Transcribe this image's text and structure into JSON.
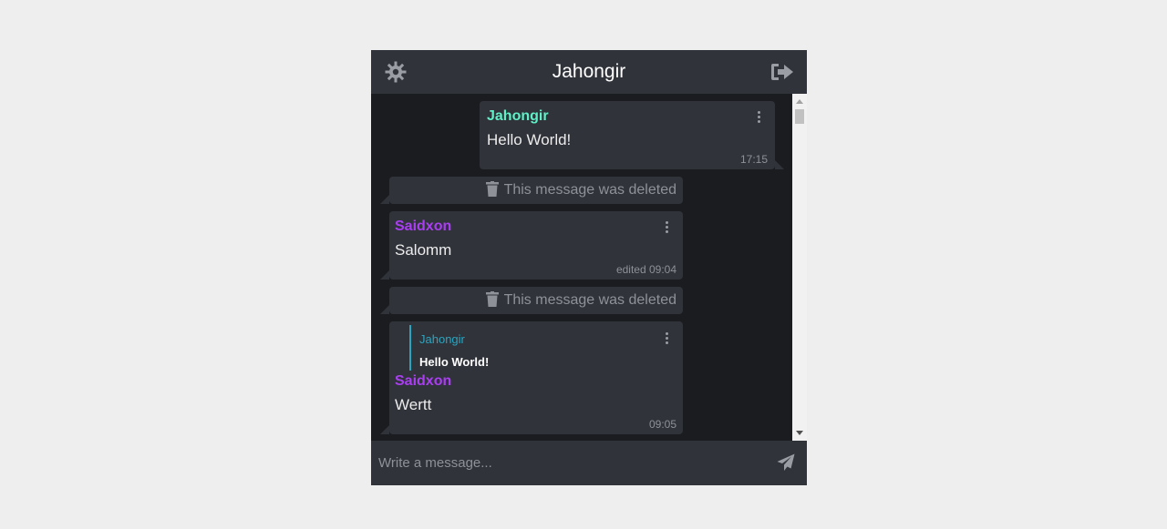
{
  "header": {
    "title": "Jahongir",
    "settings_icon": "gear-icon",
    "logout_icon": "sign-out-icon"
  },
  "colors": {
    "page_bg": "#eeeeee",
    "chat_bg": "#1b1c1f",
    "bubble_bg": "#30333a",
    "self_name": "#5ff0c8",
    "other_name": "#a93ff0",
    "reply_accent": "#2aa5c0"
  },
  "messages": [
    {
      "type": "outgoing",
      "sender": "Jahongir",
      "text": "Hello World!",
      "time": "17:15"
    },
    {
      "type": "deleted",
      "text": "This message was deleted"
    },
    {
      "type": "incoming",
      "sender": "Saidxon",
      "text": "Salomm",
      "time": "edited 09:04"
    },
    {
      "type": "deleted",
      "text": "This message was deleted"
    },
    {
      "type": "incoming",
      "sender": "Saidxon",
      "text": "Wertt",
      "time": "09:05",
      "reply": {
        "sender": "Jahongir",
        "text": "Hello World!"
      }
    }
  ],
  "composer": {
    "placeholder": "Write a message...",
    "send_icon": "paper-plane-icon"
  }
}
